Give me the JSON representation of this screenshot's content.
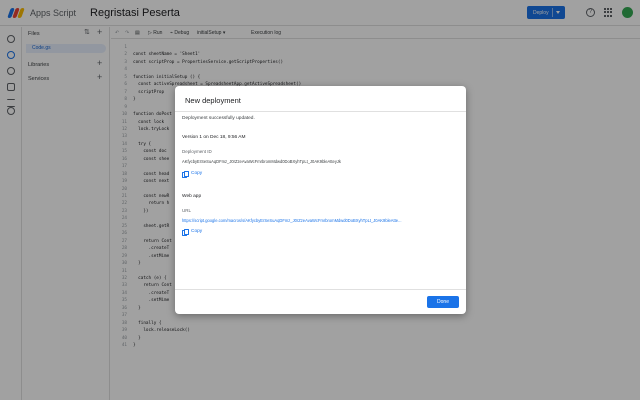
{
  "header": {
    "app_name": "Apps Script",
    "project_name": "Regristasi Peserta",
    "deploy_label": "Deploy",
    "help_glyph": "?",
    "logo_colors": [
      "#1a73e8",
      "#ea4335",
      "#fbbc04",
      "#34a853"
    ]
  },
  "files_panel": {
    "title": "Files",
    "file": "Code.gs",
    "libraries": "Libraries",
    "services": "Services"
  },
  "toolbar": {
    "run": "Run",
    "debug": "Debug",
    "function": "initialSetup",
    "execution_log": "Execution log"
  },
  "code": [
    {
      "n": "1",
      "t": ""
    },
    {
      "n": "2",
      "t": "const sheetName = 'Sheet1'"
    },
    {
      "n": "3",
      "t": "const scriptProp = PropertiesService.getScriptProperties()"
    },
    {
      "n": "4",
      "t": ""
    },
    {
      "n": "5",
      "t": "function initialSetup () {"
    },
    {
      "n": "6",
      "t": "  const activeSpreadsheet = SpreadsheetApp.getActiveSpreadsheet()"
    },
    {
      "n": "7",
      "t": "  scriptProp"
    },
    {
      "n": "8",
      "t": "}"
    },
    {
      "n": "9",
      "t": ""
    },
    {
      "n": "10",
      "t": "function doPost"
    },
    {
      "n": "11",
      "t": "  const lock"
    },
    {
      "n": "12",
      "t": "  lock.tryLock"
    },
    {
      "n": "13",
      "t": ""
    },
    {
      "n": "14",
      "t": "  try {"
    },
    {
      "n": "15",
      "t": "    const doc"
    },
    {
      "n": "16",
      "t": "    const shee"
    },
    {
      "n": "17",
      "t": ""
    },
    {
      "n": "18",
      "t": "    const head"
    },
    {
      "n": "19",
      "t": "    const next"
    },
    {
      "n": "20",
      "t": ""
    },
    {
      "n": "21",
      "t": "    const newR"
    },
    {
      "n": "22",
      "t": "      return h"
    },
    {
      "n": "23",
      "t": "    })"
    },
    {
      "n": "24",
      "t": ""
    },
    {
      "n": "25",
      "t": "    sheet.getR"
    },
    {
      "n": "26",
      "t": ""
    },
    {
      "n": "27",
      "t": "    return Cont"
    },
    {
      "n": "28",
      "t": "      .createT"
    },
    {
      "n": "29",
      "t": "      .setMime"
    },
    {
      "n": "30",
      "t": "  }"
    },
    {
      "n": "31",
      "t": ""
    },
    {
      "n": "32",
      "t": "  catch (e) {"
    },
    {
      "n": "33",
      "t": "    return Cont"
    },
    {
      "n": "34",
      "t": "      .createT"
    },
    {
      "n": "35",
      "t": "      .setMime"
    },
    {
      "n": "36",
      "t": "  }"
    },
    {
      "n": "37",
      "t": ""
    },
    {
      "n": "38",
      "t": "  finally {"
    },
    {
      "n": "39",
      "t": "    lock.releaseLock()"
    },
    {
      "n": "40",
      "t": "  }"
    },
    {
      "n": "41",
      "t": "}"
    }
  ],
  "dialog": {
    "title": "New deployment",
    "success": "Deployment successfully updated.",
    "version": "Version 1 on Dec 18, 9:56 AM",
    "deployment_id_label": "Deployment ID",
    "deployment_id": "AKfycbyErSeSuAqDFmz_J0rZzeAvaWcFmrbromMdwd0DoBXyhTpLt_J0AK9bleAtteyJk",
    "copy_label": "Copy",
    "webapp_heading": "Web app",
    "url_label": "URL",
    "url": "https://script.google.com/macros/s/AKfycbyErSeSuAqDFmz_J0rZzeAvaWcFmrbromMdwd0DoBXyhTpLt_J0AK9bleAtte...",
    "done_label": "Done"
  }
}
